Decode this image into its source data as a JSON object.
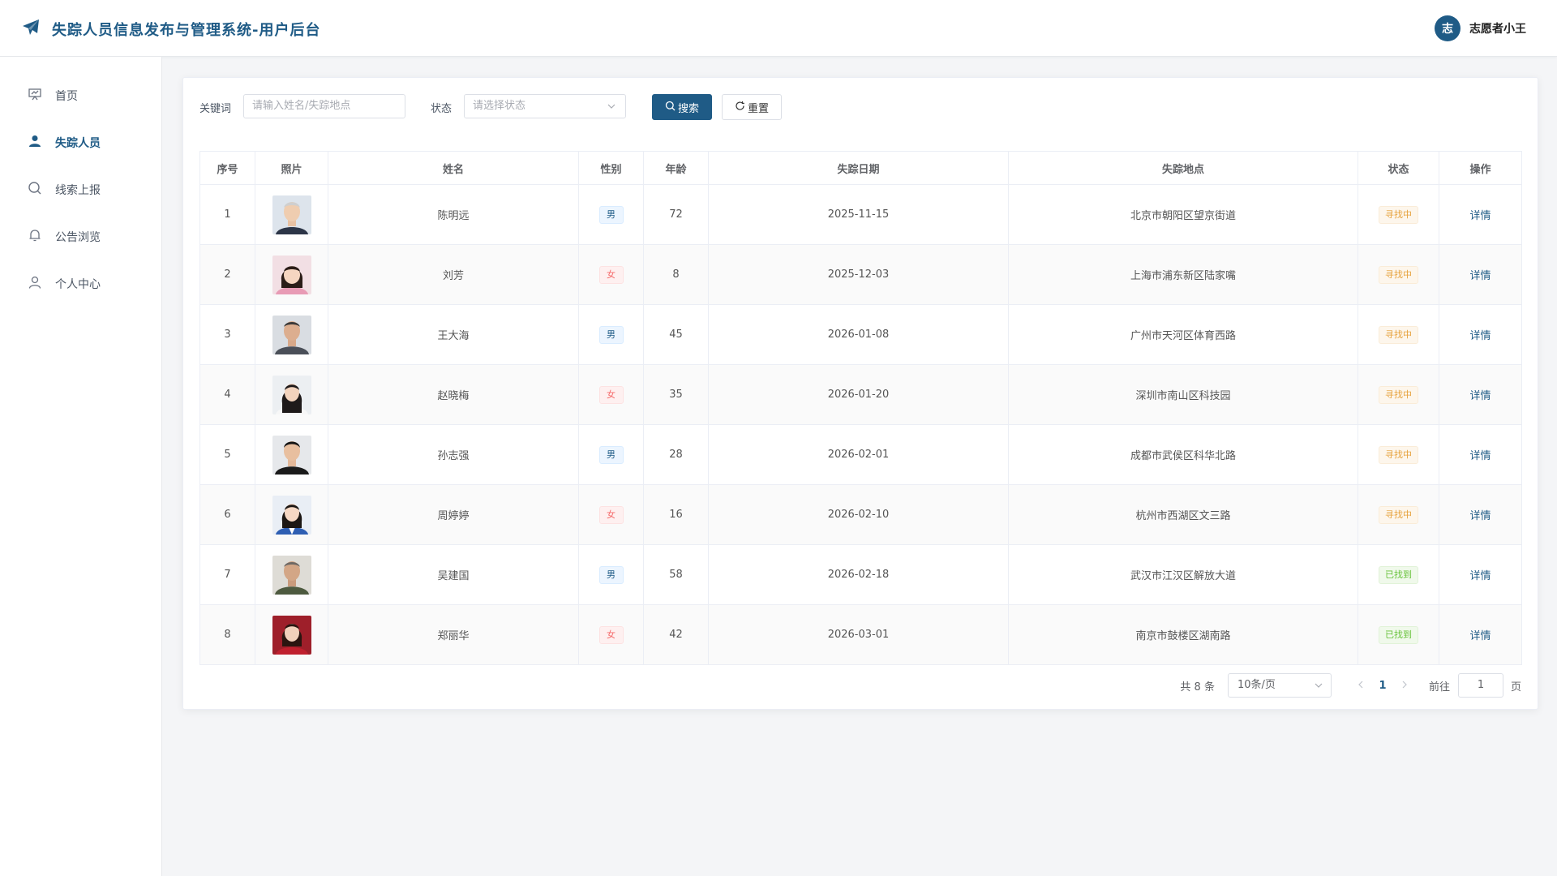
{
  "header": {
    "title": "失踪人员信息发布与管理系统-用户后台",
    "avatar_char": "志",
    "user_name": "志愿者小王"
  },
  "sidebar": {
    "items": [
      {
        "label": "首页",
        "icon": "presentation-icon"
      },
      {
        "label": "失踪人员",
        "icon": "user-icon",
        "active": true
      },
      {
        "label": "线索上报",
        "icon": "search-icon"
      },
      {
        "label": "公告浏览",
        "icon": "bell-icon"
      },
      {
        "label": "个人中心",
        "icon": "user-outline-icon"
      }
    ]
  },
  "filters": {
    "keyword_label": "关键词",
    "keyword_placeholder": "请输入姓名/失踪地点",
    "status_label": "状态",
    "status_placeholder": "请选择状态",
    "search_button": "搜索",
    "reset_button": "重置"
  },
  "table": {
    "columns": [
      "序号",
      "照片",
      "姓名",
      "性别",
      "年龄",
      "失踪日期",
      "失踪地点",
      "状态",
      "操作"
    ],
    "rows": [
      {
        "index": "1",
        "name": "陈明远",
        "gender": "男",
        "age": "72",
        "date": "2025-11-15",
        "location": "北京市朝阳区望京街道",
        "status": "寻找中",
        "action": "详情"
      },
      {
        "index": "2",
        "name": "刘芳",
        "gender": "女",
        "age": "8",
        "date": "2025-12-03",
        "location": "上海市浦东新区陆家嘴",
        "status": "寻找中",
        "action": "详情"
      },
      {
        "index": "3",
        "name": "王大海",
        "gender": "男",
        "age": "45",
        "date": "2026-01-08",
        "location": "广州市天河区体育西路",
        "status": "寻找中",
        "action": "详情"
      },
      {
        "index": "4",
        "name": "赵晓梅",
        "gender": "女",
        "age": "35",
        "date": "2026-01-20",
        "location": "深圳市南山区科技园",
        "status": "寻找中",
        "action": "详情"
      },
      {
        "index": "5",
        "name": "孙志强",
        "gender": "男",
        "age": "28",
        "date": "2026-02-01",
        "location": "成都市武侯区科华北路",
        "status": "寻找中",
        "action": "详情"
      },
      {
        "index": "6",
        "name": "周婷婷",
        "gender": "女",
        "age": "16",
        "date": "2026-02-10",
        "location": "杭州市西湖区文三路",
        "status": "寻找中",
        "action": "详情"
      },
      {
        "index": "7",
        "name": "吴建国",
        "gender": "男",
        "age": "58",
        "date": "2026-02-18",
        "location": "武汉市江汉区解放大道",
        "status": "已找到",
        "action": "详情"
      },
      {
        "index": "8",
        "name": "郑丽华",
        "gender": "女",
        "age": "42",
        "date": "2026-03-01",
        "location": "南京市鼓楼区湖南路",
        "status": "已找到",
        "action": "详情"
      }
    ]
  },
  "pagination": {
    "total": "共 8 条",
    "page_size": "10条/页",
    "current_page": "1",
    "goto_label": "前往",
    "goto_value": "1",
    "page_suffix": "页"
  },
  "colors": {
    "brand": "#1f5b86",
    "searching": "#e6a23c",
    "found": "#67c23a",
    "female": "#f56c6c"
  }
}
